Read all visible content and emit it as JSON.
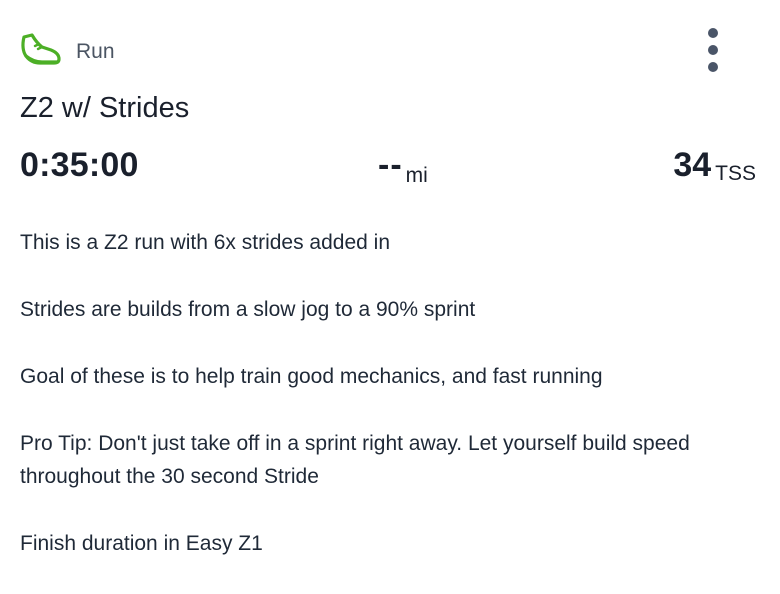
{
  "header": {
    "activity_icon": "running-shoe-icon",
    "activity_type": "Run",
    "menu_icon": "vertical-ellipsis-icon"
  },
  "workout": {
    "title": "Z2 w/ Strides",
    "duration": "0:35:00",
    "distance_value": "--",
    "distance_unit": "mi",
    "tss_value": "34",
    "tss_unit": "TSS"
  },
  "description": {
    "paragraphs": [
      "This is a Z2 run with 6x strides added in",
      "Strides are builds from a slow jog to a 90% sprint",
      "Goal of these is to help train good mechanics, and fast running",
      "Pro Tip: Don't just take off in a sprint right away. Let yourself build speed throughout the 30 second Stride",
      "Finish duration in Easy Z1"
    ]
  },
  "colors": {
    "icon_green": "#4caf26",
    "text_dark": "#1a202c",
    "text_muted": "#4b5563",
    "menu_dots": "#4a5568"
  }
}
